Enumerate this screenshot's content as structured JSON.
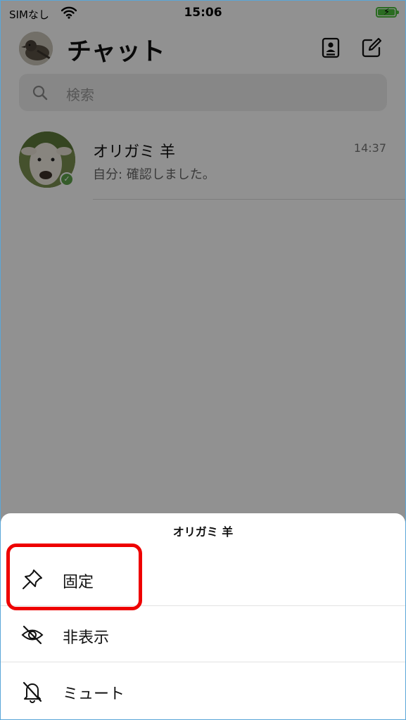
{
  "status_bar": {
    "carrier": "SIMなし",
    "time": "15:06",
    "battery_charging": true
  },
  "header": {
    "title": "チャット"
  },
  "search": {
    "placeholder": "検索"
  },
  "chats": [
    {
      "name": "オリガミ 羊",
      "time": "14:37",
      "last_message": "自分: 確認しました。",
      "online": true
    }
  ],
  "action_sheet": {
    "title": "オリガミ 羊",
    "options": [
      {
        "label": "固定",
        "icon": "pin-icon"
      },
      {
        "label": "非表示",
        "icon": "eye-off-icon"
      },
      {
        "label": "ミュート",
        "icon": "bell-off-icon"
      }
    ]
  },
  "colors": {
    "highlight": "#ee0000",
    "online": "#5da34a",
    "battery": "#4bbf3a"
  }
}
